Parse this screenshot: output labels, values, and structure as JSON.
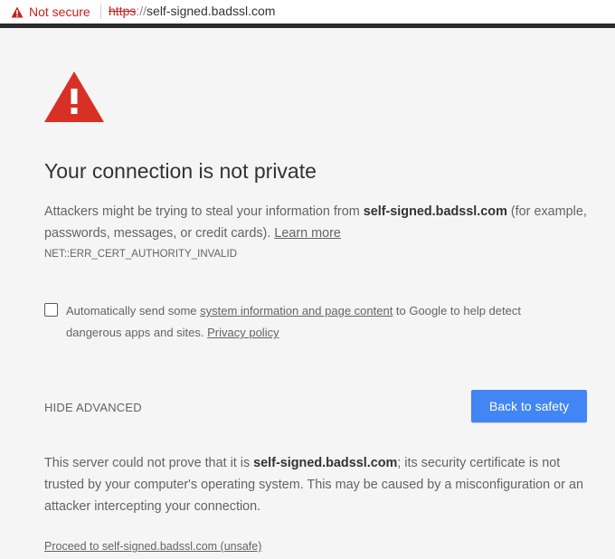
{
  "address_bar": {
    "security_label": "Not secure",
    "url_scheme": "https",
    "url_separator": "://",
    "url_host": "self-signed.badssl.com"
  },
  "colors": {
    "warning_red": "#d93025",
    "button_blue": "#4285f4",
    "page_background": "#f5f5f5"
  },
  "main": {
    "title": "Your connection is not private",
    "intro_before": "Attackers might be trying to steal your information from ",
    "intro_host": "self-signed.badssl.com",
    "intro_after": " (for example, passwords, messages, or credit cards). ",
    "learn_more": "Learn more",
    "error_code": "NET::ERR_CERT_AUTHORITY_INVALID",
    "optin_before": "Automatically send some ",
    "optin_link": "system information and page content",
    "optin_middle": " to Google to help detect dangerous apps and sites. ",
    "privacy_policy": "Privacy policy",
    "hide_advanced": "HIDE ADVANCED",
    "back_to_safety": "Back to safety",
    "details_before": "This server could not prove that it is ",
    "details_host": "self-signed.badssl.com",
    "details_after": "; its security certificate is not trusted by your computer's operating system. This may be caused by a misconfiguration or an attacker intercepting your connection.",
    "proceed_link": "Proceed to self-signed.badssl.com (unsafe)"
  }
}
